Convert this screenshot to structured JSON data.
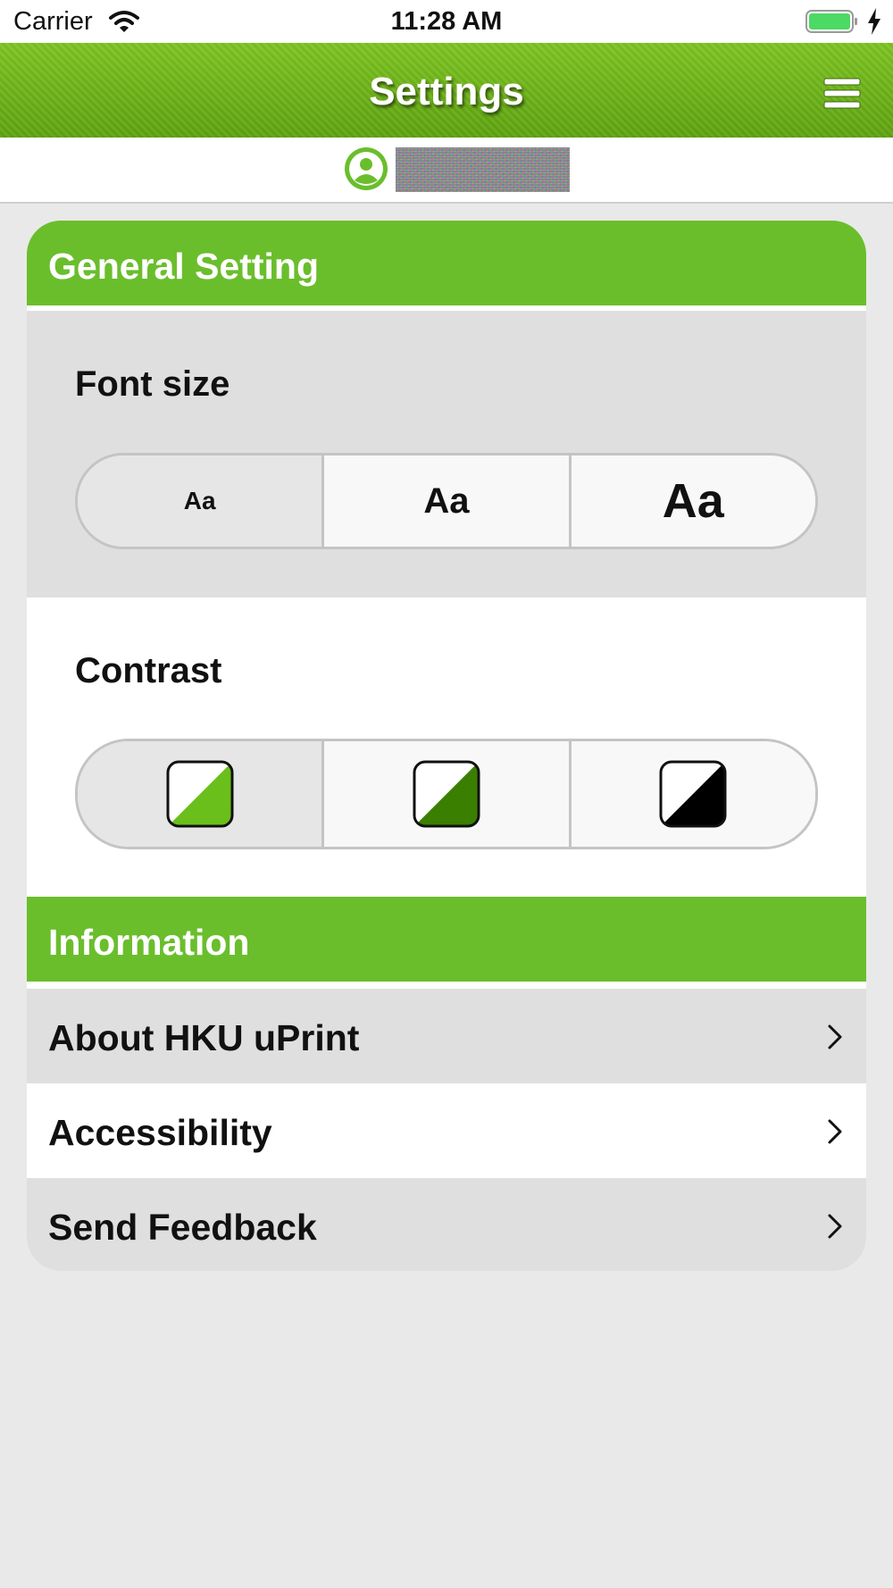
{
  "status_bar": {
    "carrier": "Carrier",
    "time": "11:28 AM",
    "battery_color": "#4cd964"
  },
  "nav": {
    "title": "Settings",
    "menu_icon": "hamburger-menu-icon"
  },
  "user": {
    "icon": "user-circle-icon",
    "name": ""
  },
  "colors": {
    "brand_green": "#6abe2c",
    "nav_green": "#6aad14"
  },
  "general": {
    "header": "General Setting",
    "font_size": {
      "label": "Font size",
      "options": [
        "Aa",
        "Aa",
        "Aa"
      ],
      "selected_index": 0
    },
    "contrast": {
      "label": "Contrast",
      "options": [
        {
          "icon": "contrast-light-green-icon",
          "color": "#6abf1a"
        },
        {
          "icon": "contrast-dark-green-icon",
          "color": "#3a7f00"
        },
        {
          "icon": "contrast-black-icon",
          "color": "#000000"
        }
      ],
      "selected_index": 0
    }
  },
  "information": {
    "header": "Information",
    "items": [
      {
        "label": "About HKU uPrint"
      },
      {
        "label": "Accessibility"
      },
      {
        "label": "Send Feedback"
      }
    ]
  }
}
